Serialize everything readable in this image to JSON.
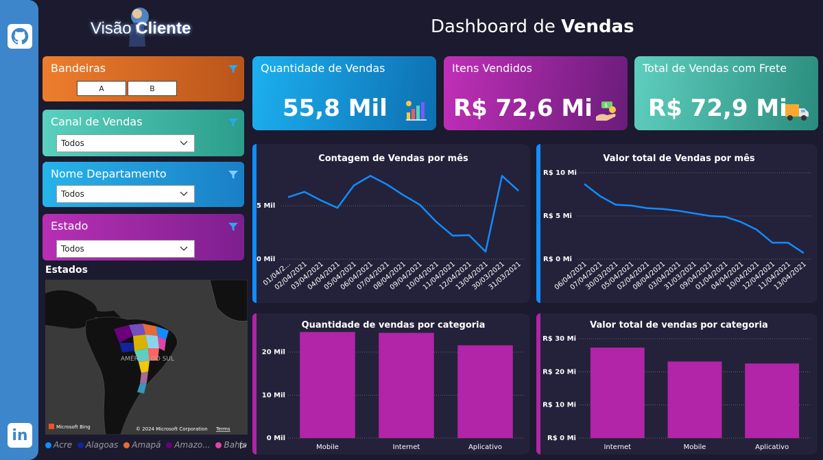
{
  "header": {
    "logo_text_light": "Visão",
    "logo_text_bold": "Cliente",
    "title_light": "Dashboard de",
    "title_bold": "Vendas"
  },
  "sidebar": {
    "icons": [
      "github-icon",
      "linkedin-icon"
    ],
    "linkedin_text": "in"
  },
  "filters": {
    "bandeiras": {
      "label": "Bandeiras",
      "options": [
        "A",
        "B"
      ]
    },
    "canal": {
      "label": "Canal de Vendas",
      "value": "Todos"
    },
    "departamento": {
      "label": "Nome Departamento",
      "value": "Todos"
    },
    "estado": {
      "label": "Estado",
      "value": "Todos"
    }
  },
  "map": {
    "title": "Estados",
    "region_label": "AMÉRICA DO SUL",
    "bing": "Microsoft Bing",
    "copyright": "© 2024 Microsoft Corporation",
    "terms": "Terms",
    "legend": [
      {
        "name": "Acre",
        "color": "#118dff"
      },
      {
        "name": "Alagoas",
        "color": "#12239e"
      },
      {
        "name": "Amapá",
        "color": "#e66c37"
      },
      {
        "name": "Amazo...",
        "color": "#6b007b"
      },
      {
        "name": "Bahia",
        "color": "#e044a7"
      }
    ]
  },
  "kpis": [
    {
      "label": "Quantidade de Vendas",
      "value": "55,8 Mil",
      "icon": "bar-chart-icon"
    },
    {
      "label": "Itens Vendidos",
      "value": "R$ 72,6 Mi",
      "icon": "money-hand-icon"
    },
    {
      "label": "Total de Vendas com Frete",
      "value": "R$ 72,9 Mi",
      "icon": "truck-icon"
    }
  ],
  "colors": {
    "line": "#118dff",
    "bar": "#b224a8",
    "accent_blue": "#118dff",
    "accent_purple": "#b224a8"
  },
  "chart_data": [
    {
      "type": "line",
      "title": "Contagem de Vendas por mês",
      "x": [
        "01/04/2...",
        "02/04/2021",
        "03/04/2021",
        "04/04/2021",
        "05/04/2021",
        "06/04/2021",
        "07/04/2021",
        "08/04/2021",
        "09/04/2021",
        "10/04/2021",
        "11/04/2021",
        "12/04/2021",
        "13/04/2021",
        "30/03/2021",
        "31/03/2021"
      ],
      "values": [
        5800,
        6300,
        5500,
        4800,
        6900,
        7800,
        7000,
        6000,
        5100,
        3500,
        2200,
        2250,
        700,
        7800,
        6400
      ],
      "ylim": [
        0,
        9500
      ],
      "yticks": [
        0,
        5000
      ],
      "ytick_labels": [
        "0 Mil",
        "5 Mil"
      ]
    },
    {
      "type": "line",
      "title": "Valor total de Vendas por mês",
      "x": [
        "06/04/2021",
        "07/04/2021",
        "30/03/2021",
        "05/04/2021",
        "02/04/2021",
        "08/04/2021",
        "03/04/2021",
        "31/03/2021",
        "09/04/2021",
        "01/04/2021",
        "04/04/2021",
        "10/04/2021",
        "12/04/2021",
        "11/04/2021",
        "13/04/2021"
      ],
      "values": [
        8.7,
        7.3,
        6.3,
        6.2,
        5.9,
        5.8,
        5.6,
        5.3,
        5.0,
        4.9,
        4.3,
        3.4,
        1.9,
        1.9,
        0.7
      ],
      "ylim": [
        0,
        10
      ],
      "yticks": [
        0,
        5,
        10
      ],
      "ytick_labels": [
        "R$ 0 Mi",
        "R$ 5 Mi",
        "R$ 10 Mi"
      ]
    },
    {
      "type": "bar",
      "title": "Quantidade de vendas por categoria",
      "categories": [
        "Mobile",
        "Internet",
        "Aplicativo"
      ],
      "values": [
        24700,
        24500,
        21600
      ],
      "ylim": [
        0,
        26500
      ],
      "yticks": [
        0,
        10000,
        20000
      ],
      "ytick_labels": [
        "0 Mil",
        "10 Mil",
        "20 Mil"
      ]
    },
    {
      "type": "bar",
      "title": "Valor total de vendas por categoria",
      "categories": [
        "Internet",
        "Mobile",
        "Aplicativo"
      ],
      "values": [
        27.3,
        23.1,
        22.5
      ],
      "ylim": [
        0,
        30
      ],
      "yticks": [
        0,
        10,
        20,
        30
      ],
      "ytick_labels": [
        "R$ 0 Mi",
        "R$ 10 Mi",
        "R$ 20 Mi",
        "R$ 30 Mi"
      ]
    }
  ]
}
